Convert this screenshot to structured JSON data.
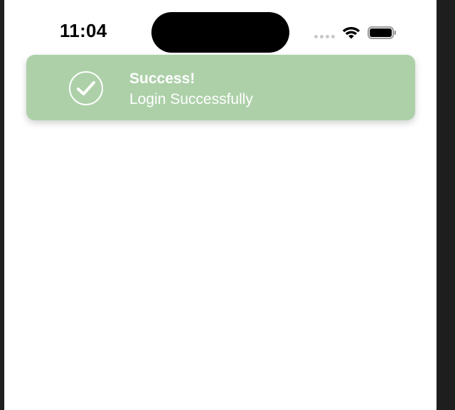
{
  "status_bar": {
    "time": "11:04",
    "wifi_icon": "wifi-icon",
    "battery_icon": "battery-icon"
  },
  "toast": {
    "title": "Success!",
    "message": "Login Successfully",
    "icon": "check-circle-icon",
    "background_color": "#add0a9",
    "text_color": "#ffffff"
  }
}
